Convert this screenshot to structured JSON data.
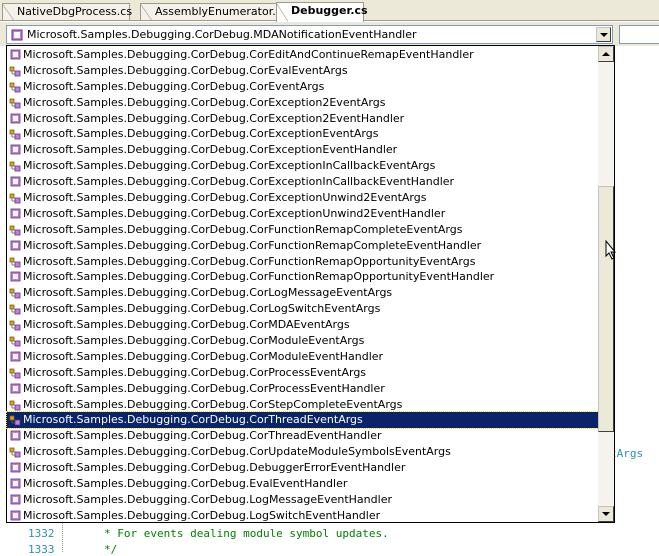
{
  "tabs": [
    {
      "label": "NativeDbgProcess.cs",
      "active": false
    },
    {
      "label": "AssemblyEnumerator.cs",
      "active": false
    },
    {
      "label": "Debugger.cs",
      "active": true
    }
  ],
  "type_selector": {
    "selected": "Microsoft.Samples.Debugging.CorDebug.MDANotificationEventHandler",
    "icon": "delegate-icon"
  },
  "member_selector": {
    "selected": ""
  },
  "dropdown": {
    "items": [
      {
        "label": "Microsoft.Samples.Debugging.CorDebug.CorEditAndContinueRemapEventHandler",
        "icon": "delegate-icon"
      },
      {
        "label": "Microsoft.Samples.Debugging.CorDebug.CorEvalEventArgs",
        "icon": "class-icon"
      },
      {
        "label": "Microsoft.Samples.Debugging.CorDebug.CorEventArgs",
        "icon": "class-icon"
      },
      {
        "label": "Microsoft.Samples.Debugging.CorDebug.CorException2EventArgs",
        "icon": "class-icon"
      },
      {
        "label": "Microsoft.Samples.Debugging.CorDebug.CorException2EventHandler",
        "icon": "delegate-icon"
      },
      {
        "label": "Microsoft.Samples.Debugging.CorDebug.CorExceptionEventArgs",
        "icon": "class-icon"
      },
      {
        "label": "Microsoft.Samples.Debugging.CorDebug.CorExceptionEventHandler",
        "icon": "delegate-icon"
      },
      {
        "label": "Microsoft.Samples.Debugging.CorDebug.CorExceptionInCallbackEventArgs",
        "icon": "class-icon"
      },
      {
        "label": "Microsoft.Samples.Debugging.CorDebug.CorExceptionInCallbackEventHandler",
        "icon": "delegate-icon"
      },
      {
        "label": "Microsoft.Samples.Debugging.CorDebug.CorExceptionUnwind2EventArgs",
        "icon": "class-icon"
      },
      {
        "label": "Microsoft.Samples.Debugging.CorDebug.CorExceptionUnwind2EventHandler",
        "icon": "delegate-icon"
      },
      {
        "label": "Microsoft.Samples.Debugging.CorDebug.CorFunctionRemapCompleteEventArgs",
        "icon": "class-icon"
      },
      {
        "label": "Microsoft.Samples.Debugging.CorDebug.CorFunctionRemapCompleteEventHandler",
        "icon": "delegate-icon"
      },
      {
        "label": "Microsoft.Samples.Debugging.CorDebug.CorFunctionRemapOpportunityEventArgs",
        "icon": "class-icon"
      },
      {
        "label": "Microsoft.Samples.Debugging.CorDebug.CorFunctionRemapOpportunityEventHandler",
        "icon": "delegate-icon"
      },
      {
        "label": "Microsoft.Samples.Debugging.CorDebug.CorLogMessageEventArgs",
        "icon": "class-icon"
      },
      {
        "label": "Microsoft.Samples.Debugging.CorDebug.CorLogSwitchEventArgs",
        "icon": "class-icon"
      },
      {
        "label": "Microsoft.Samples.Debugging.CorDebug.CorMDAEventArgs",
        "icon": "class-icon"
      },
      {
        "label": "Microsoft.Samples.Debugging.CorDebug.CorModuleEventArgs",
        "icon": "class-icon"
      },
      {
        "label": "Microsoft.Samples.Debugging.CorDebug.CorModuleEventHandler",
        "icon": "delegate-icon"
      },
      {
        "label": "Microsoft.Samples.Debugging.CorDebug.CorProcessEventArgs",
        "icon": "class-icon"
      },
      {
        "label": "Microsoft.Samples.Debugging.CorDebug.CorProcessEventHandler",
        "icon": "delegate-icon"
      },
      {
        "label": "Microsoft.Samples.Debugging.CorDebug.CorStepCompleteEventArgs",
        "icon": "class-icon"
      },
      {
        "label": "Microsoft.Samples.Debugging.CorDebug.CorThreadEventArgs",
        "icon": "class-icon",
        "selected": true
      },
      {
        "label": "Microsoft.Samples.Debugging.CorDebug.CorThreadEventHandler",
        "icon": "delegate-icon"
      },
      {
        "label": "Microsoft.Samples.Debugging.CorDebug.CorUpdateModuleSymbolsEventArgs",
        "icon": "class-icon"
      },
      {
        "label": "Microsoft.Samples.Debugging.CorDebug.DebuggerErrorEventHandler",
        "icon": "delegate-icon"
      },
      {
        "label": "Microsoft.Samples.Debugging.CorDebug.EvalEventHandler",
        "icon": "delegate-icon"
      },
      {
        "label": "Microsoft.Samples.Debugging.CorDebug.LogMessageEventHandler",
        "icon": "delegate-icon"
      },
      {
        "label": "Microsoft.Samples.Debugging.CorDebug.LogSwitchEventHandler",
        "icon": "delegate-icon"
      }
    ]
  },
  "editor": {
    "fragment": "tArgs",
    "lines": [
      {
        "num": "1332",
        "text": "* For events dealing module symbol updates."
      },
      {
        "num": "1333",
        "text": "*/"
      }
    ]
  },
  "colors": {
    "selection": "#0a246a",
    "chrome": "#ece9d8",
    "line_number": "#2b91af",
    "comment": "#008000"
  }
}
